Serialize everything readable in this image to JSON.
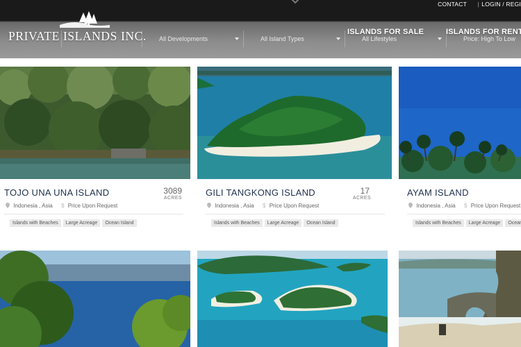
{
  "header": {
    "logo_text": "PRIVATE ISLANDS INC.",
    "top_links": {
      "contact": "CONTACT",
      "separator": "|",
      "login": "LOGIN / REGI"
    },
    "nav": {
      "for_sale": "ISLANDS FOR SALE",
      "for_rent": "ISLANDS FOR RENT"
    },
    "filters": {
      "location": "",
      "developments": "All Developments",
      "island_types": "All Island Types",
      "lifestyles": "All Lifestyles",
      "sort": "Price: High To Low"
    }
  },
  "listings": [
    {
      "name": "TOJO UNA UNA ISLAND",
      "acres": "3089",
      "acres_label": "ACRES",
      "location": "Indonesia , Asia",
      "price": "Price Upon Request",
      "tags": [
        "Islands with Beaches",
        "Large Acreage",
        "Ocean Island"
      ]
    },
    {
      "name": "GILI TANGKONG ISLAND",
      "acres": "17",
      "acres_label": "ACRES",
      "location": "Indonesia , Asia",
      "price": "Price Upon Request",
      "tags": [
        "Islands with Beaches",
        "Large Acreage",
        "Ocean Island"
      ]
    },
    {
      "name": "AYAM ISLAND",
      "acres": "",
      "acres_label": "",
      "location": "Indonesia , Asia",
      "price": "Price Upon Request",
      "tags": [
        "Islands with Beaches",
        "Large Acreage",
        "Ocean Island"
      ]
    }
  ],
  "colors": {
    "title_blue": "#1e2f4d",
    "header_dark": "#1a1a1a",
    "tag_bg": "#e9e9e9"
  },
  "icons": {
    "pin": "map-pin-icon",
    "price": "dollar-icon",
    "logo": "palm-trees-icon",
    "scroll": "chevron-down-icon"
  }
}
